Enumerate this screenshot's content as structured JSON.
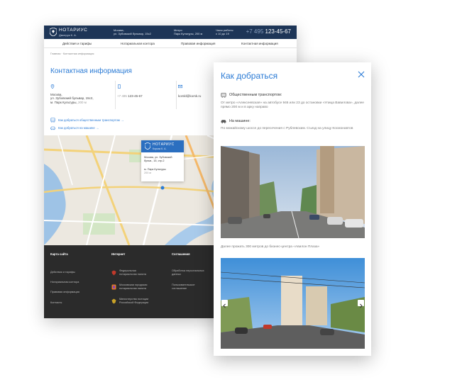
{
  "header": {
    "brand": "НОТАРИУС",
    "brand_sub": "Дмитрук К. А.",
    "address_line1": "Москва,",
    "address_line2": "ул. Зубовский бульвар, 15с2",
    "metro_label": "Метро",
    "metro_value": "Парк Культуры, 200 м",
    "hours_label": "Часы работы",
    "hours_value": "с 10 до 19",
    "phone_prefix": "+7 495",
    "phone_number": "123-45-67"
  },
  "nav": {
    "items": [
      "Действия и тарифы",
      "Нотариальная контора",
      "Правовая информация",
      "Контактная информация"
    ]
  },
  "breadcrumb": {
    "home": "Главная",
    "separator": "·",
    "current": "Контактная информация"
  },
  "page_title": "Контактная информация",
  "contact": {
    "address_lines": [
      "Москва,",
      "ул. Зубовский бульвар, 15с2,",
      "м. Парк Культуры,"
    ],
    "address_distance": "200 м",
    "phone_prefix": "+7 495",
    "phone_number": "123-45-67",
    "email": "korskl@korsk.ru"
  },
  "links": {
    "transport": "Как добраться общественным транспортом",
    "car": "Как добраться на машине"
  },
  "map_popup": {
    "brand": "НОТАРИУС",
    "brand_sub": "Корсак К. А.",
    "address_lines": [
      "Москва, ул. Зубовский",
      "бульв., 15, стр.2"
    ],
    "metro_line": "м. Парк Культуры",
    "metro_distance": "200 м"
  },
  "footer": {
    "col1_title": "Карта сайта",
    "col1_links": [
      "Действия и тарифы",
      "Нотариальная контора",
      "Правовая информация",
      "Контакты"
    ],
    "col2_title": "Интернет",
    "col2_links": [
      {
        "line1": "Федеральная",
        "line2": "нотариальная палата"
      },
      {
        "line1": "Московская городская",
        "line2": "нотариальная палата"
      },
      {
        "line1": "Министерство юстиции",
        "line2": "Российской Федерации"
      }
    ],
    "col3_title": "Соглашения",
    "col3_links": [
      {
        "line1": "Обработка персональных",
        "line2": "данных"
      },
      {
        "line1": "Пользовательское",
        "line2": "соглашение"
      }
    ]
  },
  "modal": {
    "title": "Как добраться",
    "public_heading": "Общественным транспортом:",
    "public_text": "От метро «Алексеевская» на автобусе 946 или 23 до остановки «Улица Вавилова», далее прямо 200 м и в арку направо",
    "car_heading": "На машине:",
    "car_text": "По можайскому шоссе до пересечения с Рублевским. Съезд на улицу Космонавтов",
    "caption": "Далее прожать 300 метров до бизнес-центра «Авилон Плаза»"
  },
  "colors": {
    "header_bg": "#1d3557",
    "accent": "#2b7bd5",
    "footer_bg": "#2b2b2b",
    "map_bg": "#ebe7df"
  }
}
